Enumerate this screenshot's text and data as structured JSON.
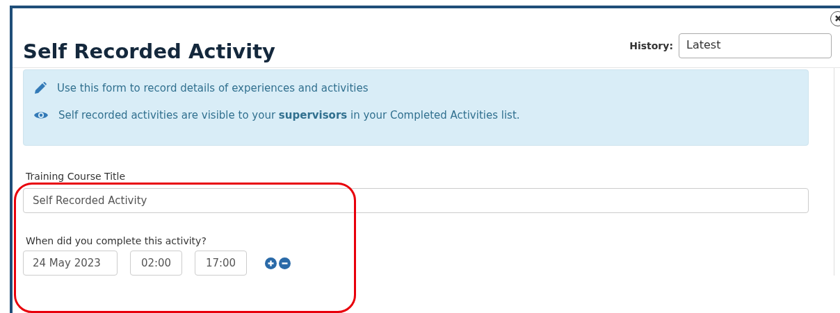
{
  "dialog": {
    "title": "Self Recorded Activity",
    "history": {
      "label": "History:",
      "value": "Latest"
    }
  },
  "info": [
    {
      "kind": "edit",
      "text": "Use this form to record details of experiences and activities"
    },
    {
      "kind": "visibility",
      "text": "Self recorded activities are visible to your **supervisors** in your Completed Activities list."
    }
  ],
  "form": {
    "title_label": "Training Course Title",
    "title_value": "Self Recorded Activity",
    "when_label": "When did you complete this activity?",
    "date": "24 May 2023",
    "start_time": "02:00",
    "end_time": "17:00"
  }
}
